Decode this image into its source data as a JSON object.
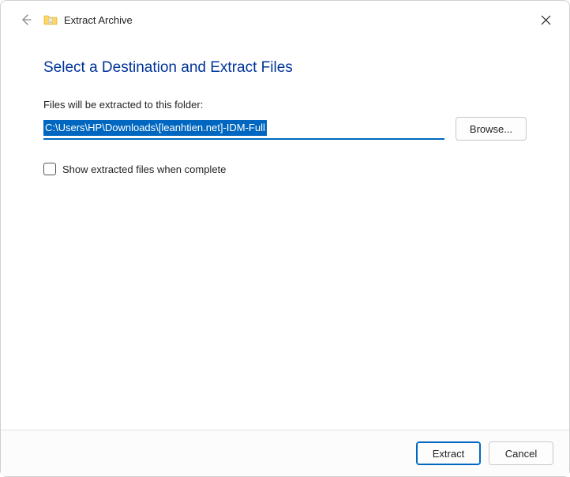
{
  "titlebar": {
    "title": "Extract Archive"
  },
  "content": {
    "heading": "Select a Destination and Extract Files",
    "path_label": "Files will be extracted to this folder:",
    "path_value": "C:\\Users\\HP\\Downloads\\[leanhtien.net]-IDM-Full",
    "browse_label": "Browse...",
    "checkbox_label": "Show extracted files when complete"
  },
  "footer": {
    "extract_label": "Extract",
    "cancel_label": "Cancel"
  }
}
